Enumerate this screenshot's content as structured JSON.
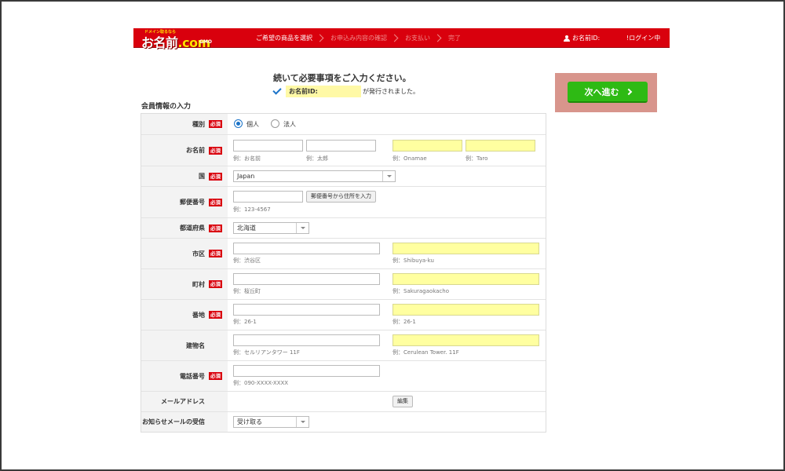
{
  "header": {
    "logo_tag": "ドメイン取るなら",
    "logo_main": "お名前",
    "logo_dotcom": ".com",
    "logo_sub": "GMO",
    "steps": [
      "ご希望の商品を選択",
      "お申込み内容の確認",
      "お支払い",
      "完了"
    ],
    "user_id_label": "お名前ID:",
    "login_label": "!ログイン中"
  },
  "intro": {
    "title": "続いて必要事項をご入力ください。",
    "id_label": "お名前ID:",
    "issued_text": "が発行されました。"
  },
  "section_title": "会員情報の入力",
  "next_button": "次へ進む",
  "required_label": "必須",
  "form": {
    "type": {
      "label": "種別",
      "options": [
        "個人",
        "法人"
      ],
      "selected": "個人"
    },
    "name": {
      "label": "お名前",
      "hints": [
        "例：お名前",
        "例：太郎",
        "例：Onamae",
        "例：Taro"
      ],
      "values": [
        "",
        "",
        "",
        ""
      ]
    },
    "country": {
      "label": "国",
      "value": "Japan"
    },
    "postal": {
      "label": "郵便番号",
      "value": "",
      "hint": "例：123-4567",
      "lookup_button": "郵便番号から住所を入力"
    },
    "prefecture": {
      "label": "都道府県",
      "value": "北海道"
    },
    "city": {
      "label": "市区",
      "hints": [
        "例：渋谷区",
        "例：Shibuya-ku"
      ]
    },
    "town": {
      "label": "町村",
      "hints": [
        "例：桜丘町",
        "例：Sakuragaokacho"
      ]
    },
    "address": {
      "label": "番地",
      "hints": [
        "例：26-1",
        "例：26-1"
      ]
    },
    "building": {
      "label": "建物名",
      "hints": [
        "例：セルリアンタワー 11F",
        "例：Cerulean Tower. 11F"
      ]
    },
    "phone": {
      "label": "電話番号",
      "hint": "例：090-XXXX-XXXX"
    },
    "email": {
      "label": "メールアドレス",
      "edit_button": "編集"
    },
    "newsletter": {
      "label": "お知らせメールの受信",
      "value": "受け取る"
    }
  },
  "colors": {
    "header_red": "#d9000d",
    "next_green": "#2eba14",
    "highlight_pink": "#d8958c",
    "yellow_field": "#ffffa0"
  }
}
